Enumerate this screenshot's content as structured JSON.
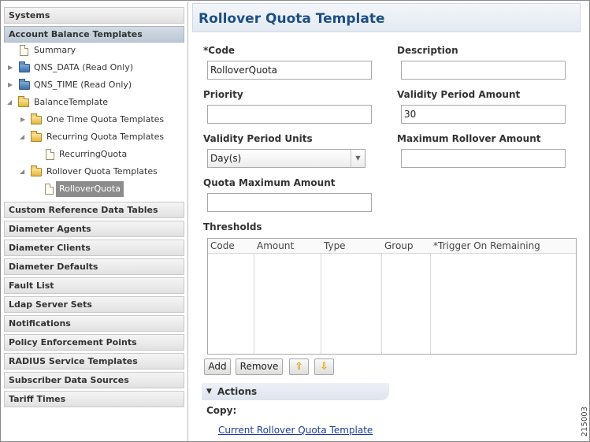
{
  "sidebar": {
    "sections_top": [
      {
        "label": "Systems",
        "active": false
      },
      {
        "label": "Account Balance Templates",
        "active": true
      }
    ],
    "tree": [
      {
        "label": "Summary",
        "icon": "file-icon"
      },
      {
        "label": "QNS_DATA (Read Only)",
        "icon": "folder-icon"
      },
      {
        "label": "QNS_TIME (Read Only)",
        "icon": "folder-icon"
      },
      {
        "label": "BalanceTemplate",
        "icon": "folder-open-icon"
      },
      {
        "label": "One Time Quota Templates",
        "icon": "folder-open-icon"
      },
      {
        "label": "Recurring Quota Templates",
        "icon": "folder-open-icon"
      },
      {
        "label": "RecurringQuota",
        "icon": "file-icon"
      },
      {
        "label": "Rollover Quota Templates",
        "icon": "folder-open-icon"
      },
      {
        "label": "RolloverQuota",
        "icon": "file-icon",
        "selected": true
      }
    ],
    "sections_bottom": [
      "Custom Reference Data Tables",
      "Diameter Agents",
      "Diameter Clients",
      "Diameter Defaults",
      "Fault List",
      "Ldap Server Sets",
      "Notifications",
      "Policy Enforcement Points",
      "RADIUS Service Templates",
      "Subscriber Data Sources",
      "Tariff Times"
    ]
  },
  "main": {
    "title": "Rollover Quota Template",
    "fields": {
      "code": {
        "label": "*Code",
        "value": "RolloverQuota"
      },
      "description": {
        "label": "Description",
        "value": ""
      },
      "priority": {
        "label": "Priority",
        "value": ""
      },
      "validity_period_amount": {
        "label": "Validity Period Amount",
        "value": "30"
      },
      "validity_period_units": {
        "label": "Validity Period Units",
        "value": "Day(s)"
      },
      "maximum_rollover_amount": {
        "label": "Maximum Rollover Amount",
        "value": ""
      },
      "quota_maximum_amount": {
        "label": "Quota Maximum Amount",
        "value": ""
      }
    },
    "thresholds": {
      "label": "Thresholds",
      "columns": [
        "Code",
        "Amount",
        "Type",
        "Group",
        "*Trigger On Remaining"
      ],
      "rows": []
    },
    "buttons": {
      "add": "Add",
      "remove": "Remove",
      "move_up": "⇧",
      "move_down": "⇩"
    },
    "actions": {
      "header": "Actions",
      "copy_label": "Copy:",
      "copy_link": "Current Rollover Quota Template"
    }
  },
  "figure_id": "215003"
}
